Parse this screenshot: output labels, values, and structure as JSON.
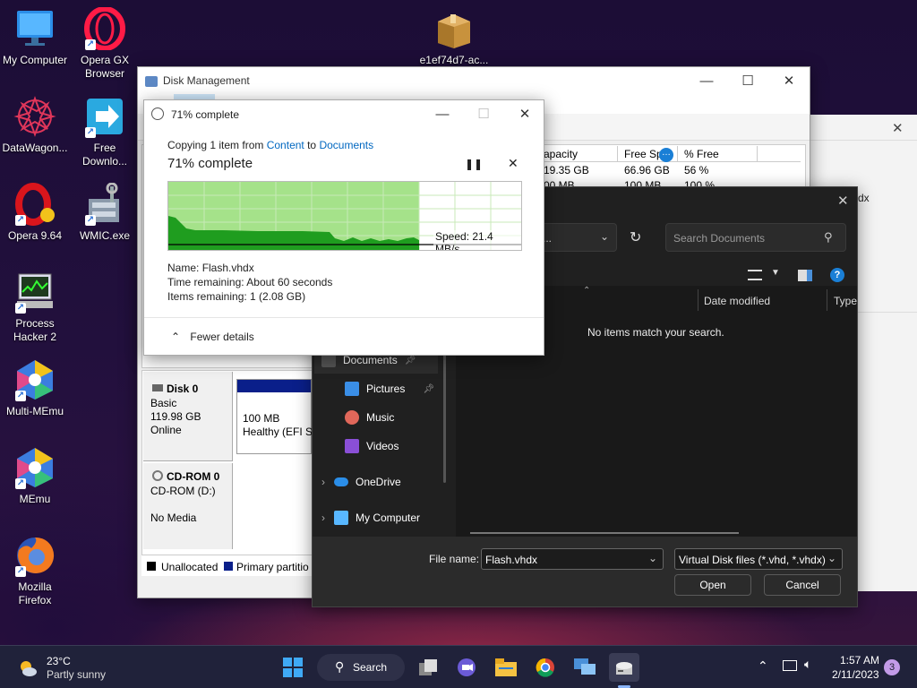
{
  "desktop": {
    "icons": [
      {
        "label1": "My Computer",
        "label2": ""
      },
      {
        "label1": "Opera GX",
        "label2": "Browser"
      },
      {
        "label1": "e1ef74d7-ac...",
        "label2": ""
      },
      {
        "label1": "DataWagon...",
        "label2": ""
      },
      {
        "label1": "Free",
        "label2": "Downlo..."
      },
      {
        "label1": "Opera 9.64",
        "label2": ""
      },
      {
        "label1": "WMIC.exe",
        "label2": ""
      },
      {
        "label1": "Process",
        "label2": "Hacker 2"
      },
      {
        "label1": "Multi-MEmu",
        "label2": ""
      },
      {
        "label1": "MEmu",
        "label2": ""
      },
      {
        "label1": "Mozilla",
        "label2": "Firefox"
      }
    ]
  },
  "disk_mgmt": {
    "title": "Disk Management",
    "columns": [
      "apacity",
      "Free Spa",
      "% Free"
    ],
    "rows": [
      [
        "19.35 GB",
        "66.96 GB",
        "56 %"
      ],
      [
        "00 MB",
        "100 MB",
        "100 %"
      ]
    ],
    "disk0": {
      "name": "Disk 0",
      "type": "Basic",
      "size": "119.98 GB",
      "status": "Online"
    },
    "partition": {
      "size": "100 MB",
      "status": "Healthy (EFI Sy"
    },
    "cdrom": {
      "name": "CD-ROM 0",
      "drive": "CD-ROM (D:)",
      "media": "No Media"
    },
    "legend": {
      "unallocated": "Unallocated",
      "primary": "Primary partitio"
    }
  },
  "copy_dialog": {
    "title": "71% complete",
    "copying_prefix": "Copying 1 item from",
    "source": "Content",
    "to_word": "to",
    "dest": "Documents",
    "heading": "71% complete",
    "progress": 0.71,
    "speed": "Speed: 21.4 MB/s",
    "name_label": "Name:",
    "name_value": "Flash.vhdx",
    "time_label": "Time remaining:",
    "time_value": "About 60 seconds",
    "items_label": "Items remaining:",
    "items_value": "1 (2.08 GB)",
    "fewer_details": "Fewer details"
  },
  "open_dialog": {
    "address_partial": "...",
    "search_placeholder": "Search Documents",
    "col_date": "Date modified",
    "col_type": "Type",
    "empty_message": "No items match your search.",
    "nav": {
      "documents": "Documents",
      "pictures": "Pictures",
      "music": "Music",
      "videos": "Videos",
      "onedrive": "OneDrive",
      "mycomputer": "My Computer"
    },
    "filename_label": "File name:",
    "filename_value": "Flash.vhdx",
    "filter_value": "Virtual Disk files (*.vhd, *.vhdx)",
    "open_label": "Open",
    "cancel_label": "Cancel",
    "behind_text": "dx"
  },
  "taskbar": {
    "weather_temp": "23°C",
    "weather_desc": "Partly sunny",
    "search_label": "Search",
    "time": "1:57 AM",
    "date": "2/11/2023",
    "notifications": "3"
  },
  "colors": {
    "accent": "#0067c0",
    "progress_green": "#9fe27f",
    "progress_dark": "#1f9d1f",
    "partition_blue": "#0a1f8a"
  }
}
